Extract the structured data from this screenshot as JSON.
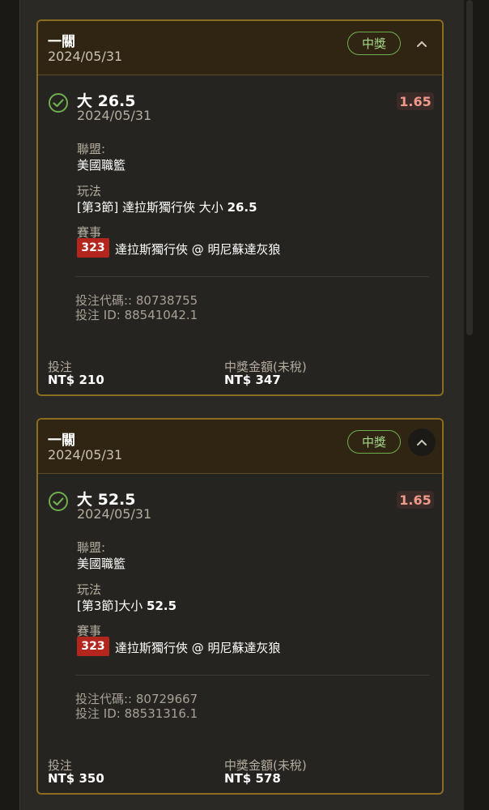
{
  "colors": {
    "accent_border": "#8a6d21",
    "win_green": "#6fae4f",
    "odds_red": "#f09a8a",
    "event_badge": "#b3261e"
  },
  "bets": [
    {
      "bet_type": "一關",
      "date": "2024/05/31",
      "status": "中獎",
      "pick": "大 26.5",
      "pick_date": "2024/05/31",
      "odds": "1.65",
      "league_label": "聯盟:",
      "league": "美國職籃",
      "play_label": "玩法",
      "play_prefix": "[第3節] 達拉斯獨行俠 大小 ",
      "play_num": "26.5",
      "event_label": "賽事",
      "event_no": "323",
      "event": "達拉斯獨行俠 @ 明尼蘇達灰狼",
      "bet_code": "投注代碼:: 80738755",
      "bet_id": "投注 ID: 88541042.1",
      "stake_label": "投注",
      "stake": "NT$ 210",
      "payout_label": "中獎金額(未稅)",
      "payout": "NT$ 347",
      "chevron_icon": "chevron-up-icon"
    },
    {
      "bet_type": "一關",
      "date": "2024/05/31",
      "status": "中獎",
      "pick": "大 52.5",
      "pick_date": "2024/05/31",
      "odds": "1.65",
      "league_label": "聯盟:",
      "league": "美國職籃",
      "play_label": "玩法",
      "play_prefix": "[第3節]大小 ",
      "play_num": "52.5",
      "event_label": "賽事",
      "event_no": "323",
      "event": "達拉斯獨行俠 @ 明尼蘇達灰狼",
      "bet_code": "投注代碼:: 80729667",
      "bet_id": "投注 ID: 88531316.1",
      "stake_label": "投注",
      "stake": "NT$ 350",
      "payout_label": "中獎金額(未稅)",
      "payout": "NT$ 578",
      "chevron_icon": "chevron-up-icon"
    }
  ]
}
